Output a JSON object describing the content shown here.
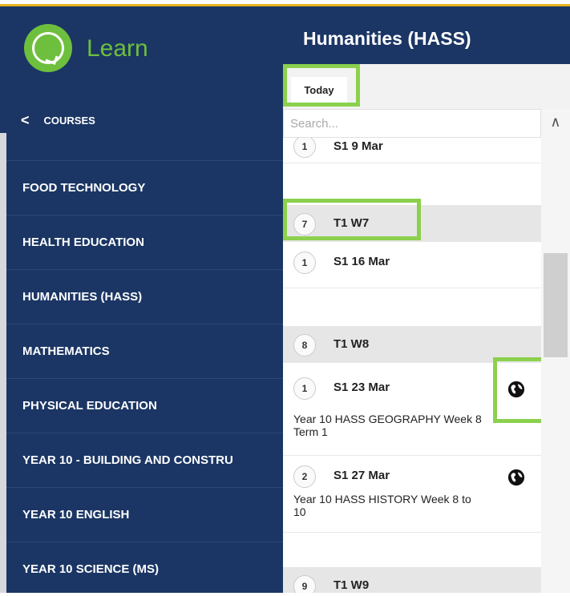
{
  "brand": {
    "name": "Learn",
    "accent": "#6ebf3e"
  },
  "header": {
    "title": "Humanities (HASS)"
  },
  "sidebar": {
    "back_label": "COURSES",
    "items": [
      {
        "label": "FOOD TECHNOLOGY"
      },
      {
        "label": "HEALTH EDUCATION"
      },
      {
        "label": "HUMANITIES (HASS)"
      },
      {
        "label": "MATHEMATICS"
      },
      {
        "label": "PHYSICAL EDUCATION"
      },
      {
        "label": "YEAR 10 - BUILDING AND CONSTRU"
      },
      {
        "label": "YEAR 10 ENGLISH"
      },
      {
        "label": "YEAR 10 SCIENCE (MS)"
      }
    ]
  },
  "toolbar": {
    "today_label": "Today"
  },
  "search": {
    "placeholder": "Search..."
  },
  "timeline": [
    {
      "type": "session",
      "badge": "1",
      "title": "S1  9 Mar"
    },
    {
      "type": "week",
      "badge": "7",
      "title": "T1  W7"
    },
    {
      "type": "session",
      "badge": "1",
      "title": "S1  16 Mar"
    },
    {
      "type": "week",
      "badge": "8",
      "title": "T1  W8"
    },
    {
      "type": "session",
      "badge": "1",
      "title": "S1  23 Mar",
      "desc": "Year 10 HASS GEOGRAPHY Week 8 Term 1",
      "icon": "globe-icon"
    },
    {
      "type": "session",
      "badge": "2",
      "title": "S1  27 Mar",
      "desc": "Year 10 HASS HISTORY Week 8 to 10",
      "icon": "globe-icon"
    },
    {
      "type": "week",
      "badge": "9",
      "title": "T1  W9"
    }
  ],
  "colors": {
    "navy": "#1b3664",
    "highlight": "#8bd14d",
    "top_stripe": "#e8b11c"
  }
}
